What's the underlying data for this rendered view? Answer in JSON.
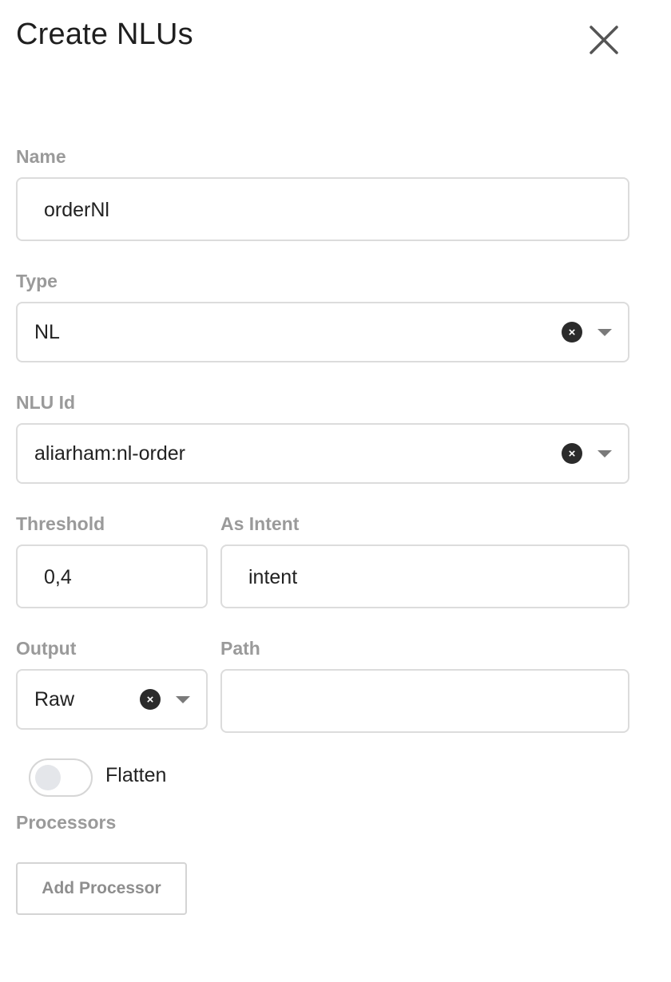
{
  "header": {
    "title": "Create NLUs",
    "close_icon": "close-icon"
  },
  "form": {
    "name": {
      "label": "Name",
      "value": "orderNl"
    },
    "type": {
      "label": "Type",
      "value": "NL"
    },
    "nlu_id": {
      "label": "NLU Id",
      "value": "aliarham:nl-order"
    },
    "threshold": {
      "label": "Threshold",
      "value": "0,4"
    },
    "as_intent": {
      "label": "As Intent",
      "value": "intent"
    },
    "output": {
      "label": "Output",
      "value": "Raw"
    },
    "path": {
      "label": "Path",
      "value": ""
    },
    "flatten": {
      "label": "Flatten",
      "enabled": false
    },
    "processors": {
      "label": "Processors",
      "add_button": "Add Processor"
    }
  },
  "icons": {
    "clear": "×",
    "dropdown": "chevron-down-icon"
  },
  "colors": {
    "label": "#9a9a9a",
    "border": "#dcdcdc",
    "clear_bg": "#2b2b2b",
    "knob": "#e4e6ea"
  }
}
